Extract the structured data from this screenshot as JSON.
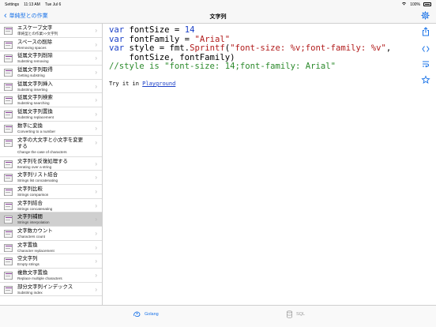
{
  "status": {
    "carrier": "Settings",
    "time": "11:13 AM",
    "date": "Tue Jul 6",
    "battery": "100%"
  },
  "nav": {
    "back_label": "単純型との作業",
    "title": "文字列"
  },
  "sidebar": {
    "items": [
      {
        "title": "エスケープ文字",
        "subtitle": "単純型との作業>>文字列"
      },
      {
        "title": "スペースの削除",
        "subtitle": "Removing spaces"
      },
      {
        "title": "従属文字列削除",
        "subtitle": "Substring removing"
      },
      {
        "title": "従属文字列取得",
        "subtitle": "Getting substring"
      },
      {
        "title": "従属文字列挿入",
        "subtitle": "Substring inserting"
      },
      {
        "title": "従属文字列検索",
        "subtitle": "Substring searching"
      },
      {
        "title": "従属文字列置換",
        "subtitle": "Substring replacement"
      },
      {
        "title": "数字に変換",
        "subtitle": "Converting to a number"
      },
      {
        "title": "文字の大文字と小文字を変更する",
        "subtitle": "Change the case of characters"
      },
      {
        "title": "文字列を反復処理する",
        "subtitle": "Iterating over a string"
      },
      {
        "title": "文字列リスト結合",
        "subtitle": "Strings list concatenating"
      },
      {
        "title": "文字列比較",
        "subtitle": "Strings comparison"
      },
      {
        "title": "文字列結合",
        "subtitle": "Strings concatenating"
      },
      {
        "title": "文字列補間",
        "subtitle": "Strings interpolation"
      },
      {
        "title": "文字数カウント",
        "subtitle": "Characters count"
      },
      {
        "title": "文字置換",
        "subtitle": "Character replacement"
      },
      {
        "title": "空文字列",
        "subtitle": "Empty strings"
      },
      {
        "title": "複数文字置換",
        "subtitle": "Replace multiple characters"
      },
      {
        "title": "部分文字列インデックス",
        "subtitle": "Substring index"
      }
    ]
  },
  "code": {
    "l1_kw": "var",
    "l1_rest": " fontSize = ",
    "l1_num": "14",
    "l2_kw": "var",
    "l2_rest": " fontFamily = ",
    "l2_str": "\"Arial\"",
    "l3_kw": "var",
    "l3_rest": " style = fmt.",
    "l3_fn": "Sprintf",
    "l3_open": "(",
    "l3_str": "\"font-size: %v;font-family: %v\"",
    "l3_end": ",",
    "l4": "    fontSize, fontFamily)",
    "l5": "//style is \"font-size: 14;font-family: Arial\""
  },
  "tryit": {
    "prefix": "Try it in ",
    "link": "Playground"
  },
  "tabs": {
    "golang": "Golang",
    "sql": "SQL"
  },
  "colors": {
    "accent": "#1a73e8",
    "keyword": "#1a3fc7",
    "string": "#b21c1c",
    "comment": "#2c8a2c"
  }
}
